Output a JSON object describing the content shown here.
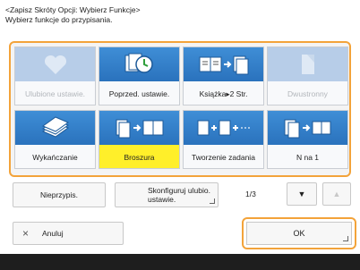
{
  "header": {
    "line1": "<Zapisz Skróty Opcji: Wybierz Funkcje>",
    "line2": "Wybierz funkcje do przypisania."
  },
  "tiles": [
    {
      "label": "Ulubione ustawie.",
      "icon": "heart-icon",
      "state": "disabled"
    },
    {
      "label": "Poprzed. ustawie.",
      "icon": "clock-icon",
      "state": "normal"
    },
    {
      "label": "Książka▸2 Str.",
      "icon": "book-to-2pages-icon",
      "state": "normal"
    },
    {
      "label": "Dwustronny",
      "icon": "duplex-page-icon",
      "state": "disabled"
    },
    {
      "label": "Wykańczanie",
      "icon": "finishing-icon",
      "state": "normal"
    },
    {
      "label": "Broszura",
      "icon": "booklet-icon",
      "state": "selected"
    },
    {
      "label": "Tworzenie zadania",
      "icon": "job-build-icon",
      "state": "normal"
    },
    {
      "label": "N na 1",
      "icon": "n-on-1-icon",
      "state": "normal"
    }
  ],
  "bottom_bar": {
    "unassign_label": "Nieprzypis.",
    "configure_label": "Skonfiguruj ulubio. ustawie.",
    "page_indicator": "1/3",
    "down_glyph": "▼",
    "up_glyph": "▲"
  },
  "actions": {
    "cancel_glyph": "×",
    "cancel_label": "Anuluj",
    "ok_label": "OK"
  },
  "colors": {
    "accent_orange": "#f3a33a",
    "tile_blue": "#2a72bd",
    "selected_yellow": "#ffef2a"
  }
}
